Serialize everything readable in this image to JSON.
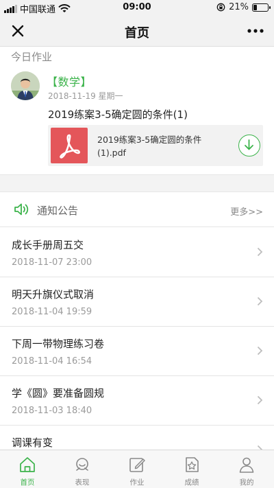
{
  "status_bar": {
    "carrier": "中国联通",
    "time": "09:00",
    "battery": "21%",
    "battery_level": 0.21
  },
  "nav": {
    "title": "首页",
    "close_icon": "close-icon",
    "more_icon": "more-icon"
  },
  "homework": {
    "heading": "今日作业",
    "subject": "【数学】",
    "date": "2018-11-19 星期一",
    "title": "2019练案3-5确定圆的条件(1)",
    "attachment": {
      "name_line1": "2019练案3-5确定圆的条件",
      "name_line2": "(1).pdf",
      "icon": "pdf-icon",
      "action_icon": "download-icon"
    }
  },
  "notices": {
    "title": "通知公告",
    "more": "更多>>",
    "icon": "speaker-icon",
    "items": [
      {
        "title": "成长手册周五交",
        "date": "2018-11-07 23:00"
      },
      {
        "title": "明天升旗仪式取消",
        "date": "2018-11-04 19:59"
      },
      {
        "title": "下周一带物理练习卷",
        "date": "2018-11-04 16:54"
      },
      {
        "title": "学《圆》要准备圆规",
        "date": "2018-11-03 18:40"
      },
      {
        "title": "调课有变",
        "date": ""
      }
    ]
  },
  "tabbar": {
    "items": [
      {
        "label": "首页",
        "icon": "home-icon",
        "active": true
      },
      {
        "label": "表现",
        "icon": "performance-icon",
        "active": false
      },
      {
        "label": "作业",
        "icon": "homework-edit-icon",
        "active": false
      },
      {
        "label": "成绩",
        "icon": "grades-icon",
        "active": false
      },
      {
        "label": "我的",
        "icon": "profile-icon",
        "active": false
      }
    ]
  },
  "colors": {
    "accent": "#3bb34a",
    "pdf": "#e4565a",
    "bar_bg": "#f2f2f2"
  }
}
